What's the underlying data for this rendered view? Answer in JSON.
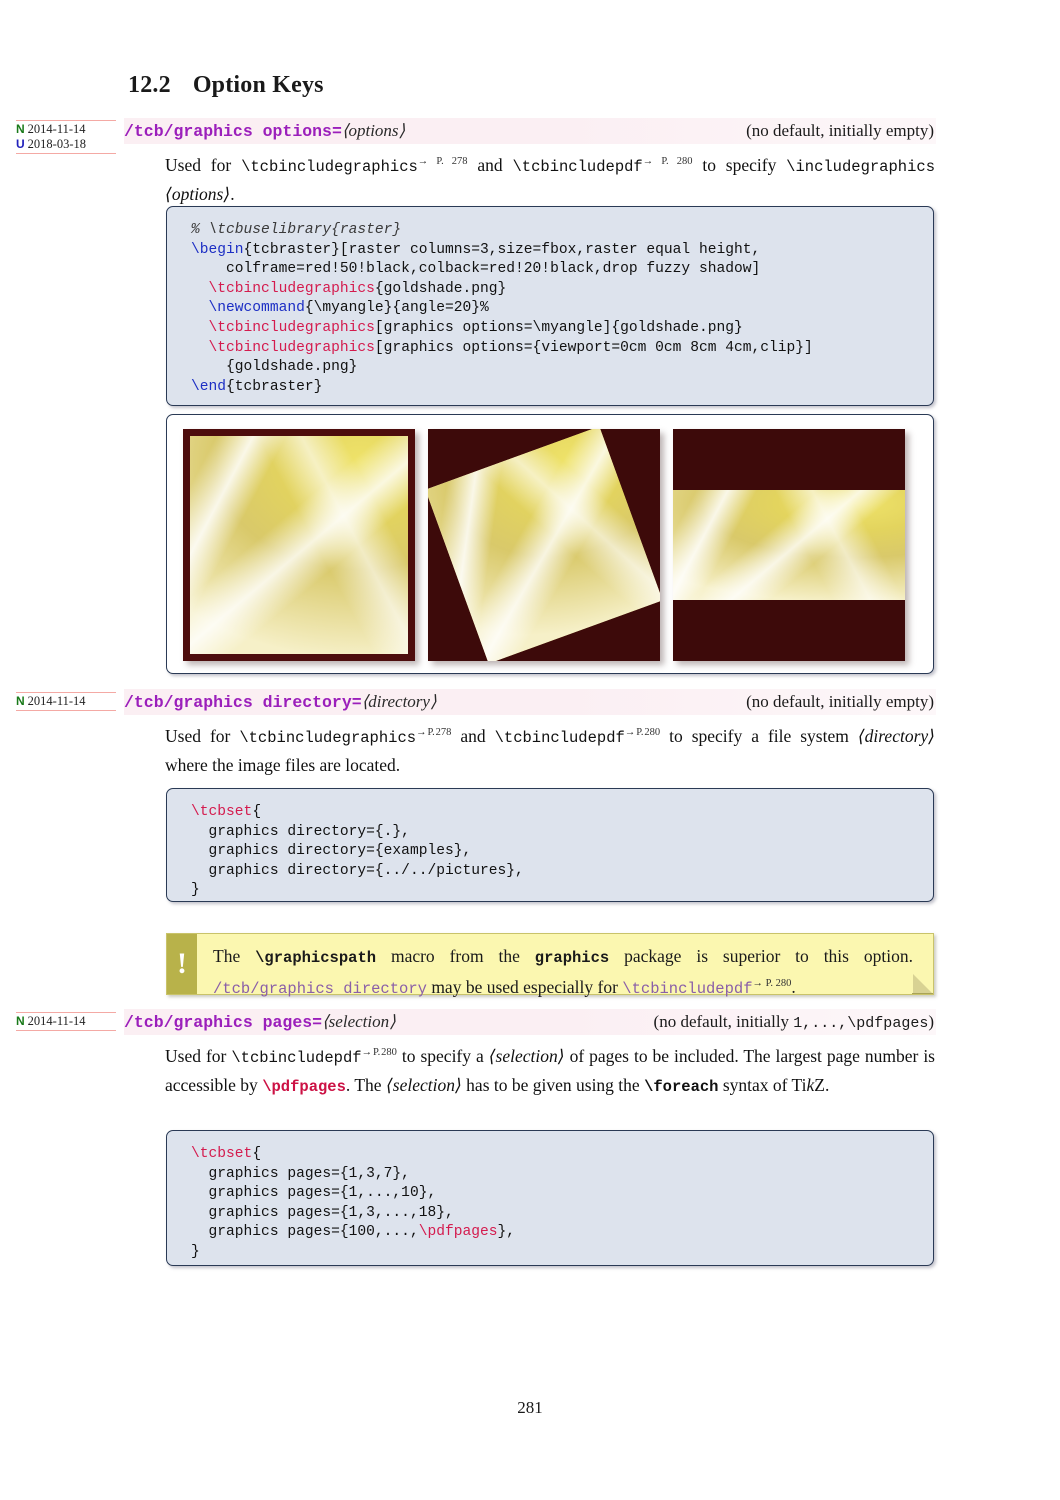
{
  "document": {
    "section_number": "12.2",
    "section_title": "Option Keys",
    "page_number": "281"
  },
  "entries": [
    {
      "markers": [
        {
          "tag": "N",
          "date": "2014-11-14"
        },
        {
          "tag": "U",
          "date": "2018-03-18"
        }
      ],
      "key_path": "/tcb/graphics options",
      "key_eq": "=",
      "key_arg": "⟨options⟩",
      "default_note_pre": "(no default, initially empty)",
      "description_parts": [
        {
          "type": "text",
          "text": "Used for "
        },
        {
          "type": "mono",
          "text": "\\tcbincludegraphics"
        },
        {
          "type": "pageref",
          "text": "→ P. 278"
        },
        {
          "type": "text",
          "text": " and "
        },
        {
          "type": "mono",
          "text": "\\tcbincludepdf"
        },
        {
          "type": "pageref",
          "text": "→ P. 280"
        },
        {
          "type": "text",
          "text": " to specify "
        },
        {
          "type": "mono",
          "text": "\\includegraphics"
        },
        {
          "type": "text",
          "text": " "
        },
        {
          "type": "italic",
          "text": "⟨options⟩"
        },
        {
          "type": "text",
          "text": "."
        }
      ],
      "code": "% \\tcbuselibrary{raster}\n\\begin{tcbraster}[raster columns=3,size=fbox,raster equal height,\n    colframe=red!50!black,colback=red!20!black,drop fuzzy shadow]\n  \\tcbincludegraphics{goldshade.png}\n  \\newcommand{\\myangle}{angle=20}%\n  \\tcbincludegraphics[graphics options=\\myangle]{goldshade.png}\n  \\tcbincludegraphics[graphics options={viewport=0cm 0cm 8cm 4cm,clip}]\n    {goldshade.png}\n\\end{tcbraster}",
      "result_images": [
        {
          "name": "goldshade-plain",
          "mode": "fill"
        },
        {
          "name": "goldshade-rotated-20deg",
          "mode": "rotate"
        },
        {
          "name": "goldshade-viewport-clip",
          "mode": "clip"
        }
      ]
    },
    {
      "markers": [
        {
          "tag": "N",
          "date": "2014-11-14"
        }
      ],
      "key_path": "/tcb/graphics directory",
      "key_eq": "=",
      "key_arg": "⟨directory⟩",
      "default_note_pre": "(no default, initially empty)",
      "code": "\\tcbset{\n  graphics directory={.},\n  graphics directory={examples},\n  graphics directory={../../pictures},\n}"
    },
    {
      "markers": [
        {
          "tag": "N",
          "date": "2014-11-14"
        }
      ],
      "key_path": "/tcb/graphics pages",
      "key_eq": "=",
      "key_arg": "⟨selection⟩",
      "default_note_pre": "(no default, initially ",
      "default_note_mono": "1,...,\\pdfpages",
      "default_note_post": ")",
      "code": "\\tcbset{\n  graphics pages={1,3,7},\n  graphics pages={1,...,10},\n  graphics pages={1,3,...,18},\n  graphics pages={100,...,\\pdfpages},\n}"
    }
  ],
  "note": {
    "icon": "exclamation-mark",
    "line1_a": "The ",
    "line1_b": "\\graphicspath",
    "line1_c": " macro from the ",
    "line1_d": "graphics",
    "line1_e": " package is superior to this option.",
    "line2_a": "/tcb/graphics directory",
    "line2_b": " may be used especially for ",
    "line2_c": "\\tcbincludepdf",
    "line2_ref": "→ P. 280",
    "line2_d": "."
  },
  "colors": {
    "key_purple": "#9b1fbb",
    "key_band_pink": "#fbeff3",
    "code_bg": "#dde3ed",
    "code_border": "#2a3a55",
    "note_bg": "#fbf7b0",
    "note_bar": "#b8b24a",
    "marker_rule": "#f4a9a4",
    "marker_new": "#1a7a1a",
    "marker_updated": "#2222bb",
    "frame_dark_red": "#4d0d0d",
    "back_dark_red": "#3d0a0a",
    "macro_red": "#d41b4e",
    "macro_blue": "#1c2ec4"
  }
}
